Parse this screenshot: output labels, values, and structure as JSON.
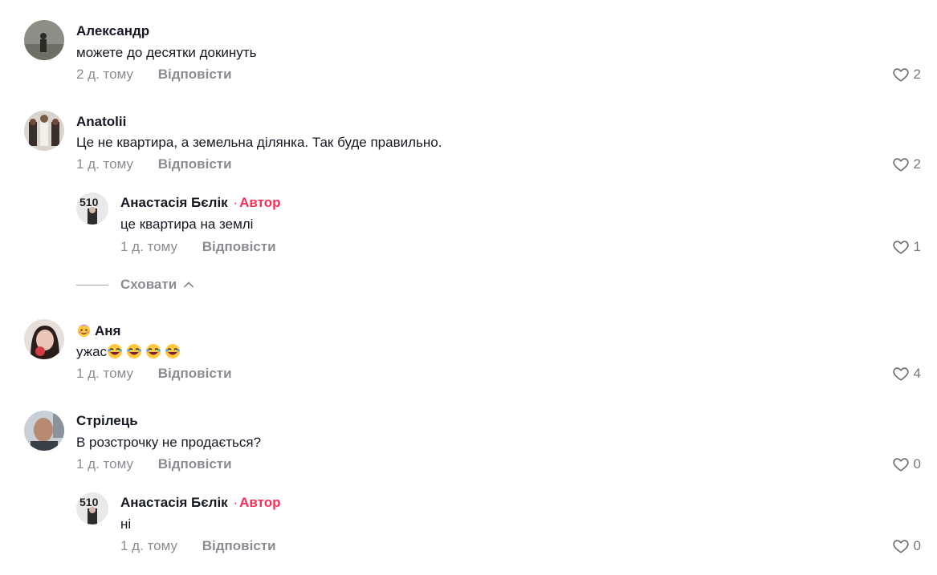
{
  "comments": [
    {
      "username": "Александр",
      "text": "можете до десятки докинуть",
      "time": "2 д. тому",
      "reply_label": "Відповісти",
      "likes": "2"
    },
    {
      "username": "Anatolii",
      "text": "Це не квартира, а земельна ділянка. Так буде правильно.",
      "time": "1 д. тому",
      "reply_label": "Відповісти",
      "likes": "2",
      "replies": [
        {
          "username": "Анастасія Бєлік",
          "author_tag": "Автор",
          "separator": "·",
          "text": "це квартира на землі",
          "time": "1 д. тому",
          "reply_label": "Відповісти",
          "likes": "1"
        }
      ],
      "hide_label": "Сховати"
    },
    {
      "username": "Аня",
      "text": "ужас",
      "time": "1 д. тому",
      "reply_label": "Відповісти",
      "likes": "4"
    },
    {
      "username": "Стрілець",
      "text": "В розстрочку не продається?",
      "time": "1 д. тому",
      "reply_label": "Відповісти",
      "likes": "0",
      "replies": [
        {
          "username": "Анастасія Бєлік",
          "author_tag": "Автор",
          "separator": "·",
          "text": "ні",
          "time": "1 д. тому",
          "reply_label": "Відповісти",
          "likes": "0"
        }
      ]
    }
  ],
  "colors": {
    "author_accent": "#fe2c55",
    "muted_text": "#8a8b91"
  },
  "icons": {
    "like": "heart-outline-icon",
    "hide": "chevron-up-icon",
    "laugh_emoji": "laughing-face-emoji",
    "badge_emoji": "blushing-face-emoji"
  }
}
